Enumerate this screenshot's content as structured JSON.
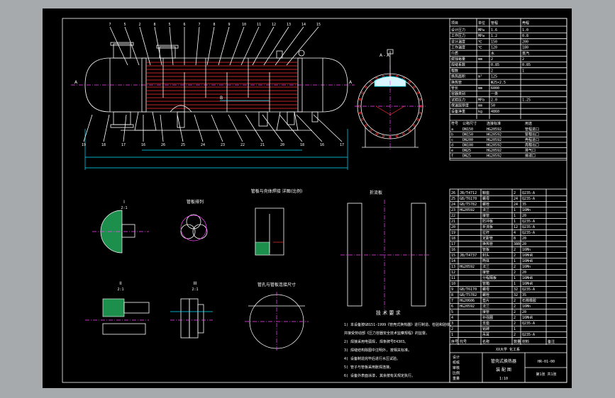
{
  "colors": {
    "app_background": "#a7aaad",
    "viewport_background": "#000000",
    "outline": "#ffffff",
    "dimension": "#00e5ff",
    "tube": "#ff3030",
    "centerline": "#ff40ff",
    "hatch": "#4cd964"
  },
  "balloons": {
    "top": [
      "7",
      "5",
      "2",
      "8",
      "5",
      "6",
      "7",
      "8",
      "9",
      "10",
      "11",
      "12",
      "13",
      "14",
      "15"
    ],
    "bottom": [
      "19",
      "18",
      "17",
      "16",
      "26",
      "25",
      "24",
      "23",
      "22",
      "21",
      "20",
      "18",
      "16",
      "17"
    ]
  },
  "main_view": {
    "section_mark_left": "A",
    "section_mark_right": "A",
    "dim_mark": "B"
  },
  "section_view": {
    "label": "A - A"
  },
  "details": {
    "detail_1_label": "I",
    "detail_1_scale": "2:1",
    "detail_2_label": "管板排列",
    "detail_3_label": "管板与壳体焊接\n详图(比例)",
    "detail_4_label": "II",
    "detail_4_scale": "2:1",
    "detail_5_label": "III",
    "detail_5_scale": "2:1",
    "detail_6_label": "管孔与管板连接尺寸",
    "baffle_label": "折流板"
  },
  "tech_requirements": {
    "heading": "技 术 要 求",
    "items": [
      "1) 本设备按GB151-1999《管壳式换热器》进行制造、检验和验收,",
      "   并接受劳动部《压力容器安全技术监察规程》的监督。",
      "2) 焊接采用电弧焊, 焊条牌号E4303。",
      "3) 焊缝结构除图中注明外, 按相关标准。",
      "4) 设备制造完毕后进行水压试验。",
      "5) 管子与管板采用胀焊连接。",
      "6) 设备外表面涂漆, 其余按有关规定执行。"
    ]
  },
  "design_table": {
    "header": [
      "项目",
      "单位",
      "管程",
      "壳程"
    ],
    "rows": [
      [
        "设计压力",
        "MPa",
        "1.6",
        "1.0"
      ],
      [
        "工作压力",
        "MPa",
        "1.2",
        "0.8"
      ],
      [
        "设计温度",
        "℃",
        "150",
        "200"
      ],
      [
        "工作温度",
        "℃",
        "120",
        "180"
      ],
      [
        "介质",
        "",
        "水",
        "蒸汽"
      ],
      [
        "腐蚀裕量",
        "mm",
        "2",
        "2"
      ],
      [
        "焊缝系数",
        "",
        "0.85",
        "0.85"
      ],
      [
        "程数",
        "",
        "2",
        "1"
      ],
      [
        "换热面积",
        "m²",
        "125",
        ""
      ],
      [
        "换热管",
        "",
        "Φ25×2.5",
        ""
      ],
      [
        "管长",
        "mm",
        "6000",
        ""
      ],
      [
        "容器类别",
        "",
        "一类",
        ""
      ],
      [
        "试验压力",
        "MPa",
        "2.0",
        "1.25"
      ],
      [
        "保温层厚度",
        "mm",
        "50",
        ""
      ],
      [
        "设备净重",
        "kg",
        "4860",
        ""
      ]
    ],
    "nozzle_header": [
      "符号",
      "公称尺寸",
      "连接标准",
      "用途"
    ],
    "nozzles": [
      [
        "a",
        "DN150",
        "HG20592",
        "管程进口"
      ],
      [
        "b",
        "DN150",
        "HG20592",
        "管程出口"
      ],
      [
        "c",
        "DN200",
        "HG20592",
        "壳程进口"
      ],
      [
        "d",
        "DN100",
        "HG20592",
        "壳程出口"
      ],
      [
        "e",
        "DN25",
        "HG20592",
        "排气口"
      ],
      [
        "f",
        "DN25",
        "HG20592",
        "排液口"
      ]
    ]
  },
  "parts_list": {
    "header": [
      "序号",
      "代号",
      "名称",
      "数量",
      "材料",
      "备注"
    ],
    "rows": [
      [
        "26",
        "JB/T4712",
        "鞍座",
        "2",
        "Q235-A",
        ""
      ],
      [
        "25",
        "GB/T6170",
        "螺母",
        "24",
        "Q235-A",
        ""
      ],
      [
        "24",
        "GB/T5782",
        "螺栓",
        "24",
        "35",
        ""
      ],
      [
        "23",
        "HG20592",
        "法兰",
        "1",
        "16Mn",
        ""
      ],
      [
        "22",
        "",
        "接管",
        "1",
        "20",
        ""
      ],
      [
        "21",
        "",
        "防冲板",
        "1",
        "Q235-A",
        ""
      ],
      [
        "20",
        "",
        "折流板",
        "12",
        "Q235-A",
        ""
      ],
      [
        "19",
        "",
        "拉杆",
        "4",
        "Q235-A",
        ""
      ],
      [
        "18",
        "",
        "定距管",
        "8",
        "20",
        ""
      ],
      [
        "17",
        "",
        "换热管",
        "380",
        "20",
        ""
      ],
      [
        "16",
        "",
        "管板",
        "2",
        "16Mn",
        ""
      ],
      [
        "15",
        "JB/T4737",
        "封头",
        "2",
        "16MnR",
        ""
      ],
      [
        "14",
        "",
        "筒体",
        "1",
        "16MnR",
        ""
      ],
      [
        "13",
        "HG20592",
        "法兰",
        "2",
        "16Mn",
        ""
      ],
      [
        "12",
        "",
        "接管",
        "2",
        "20",
        ""
      ],
      [
        "11",
        "",
        "分程隔板",
        "1",
        "16MnR",
        ""
      ],
      [
        "10",
        "",
        "管箱",
        "1",
        "16MnR",
        ""
      ],
      [
        "9",
        "GB/T6170",
        "螺母",
        "32",
        "Q235-A",
        ""
      ],
      [
        "8",
        "GB/T5782",
        "螺栓",
        "32",
        "35",
        ""
      ],
      [
        "7",
        "HG20606",
        "垫片",
        "2",
        "石棉橡胶",
        ""
      ],
      [
        "6",
        "HG20592",
        "法兰",
        "2",
        "16Mn",
        ""
      ],
      [
        "5",
        "",
        "接管",
        "2",
        "20",
        ""
      ],
      [
        "4",
        "",
        "补强圈",
        "2",
        "16MnR",
        ""
      ],
      [
        "3",
        "",
        "支座",
        "2",
        "Q235-A",
        ""
      ],
      [
        "2",
        "",
        "铭牌",
        "1",
        "",
        ""
      ],
      [
        "1",
        "",
        "吊耳",
        "2",
        "Q235-A",
        ""
      ]
    ]
  },
  "title_block": {
    "drawing_title": "管壳式换热器",
    "drawing_subtitle": "装 配 图",
    "drawing_number": "HR-01-00",
    "school": "XX大学 化工系",
    "scale": "1:10",
    "sheet": "第1张 共1张",
    "labels": [
      "设计",
      "校核",
      "审核",
      "比例",
      "重量"
    ]
  }
}
